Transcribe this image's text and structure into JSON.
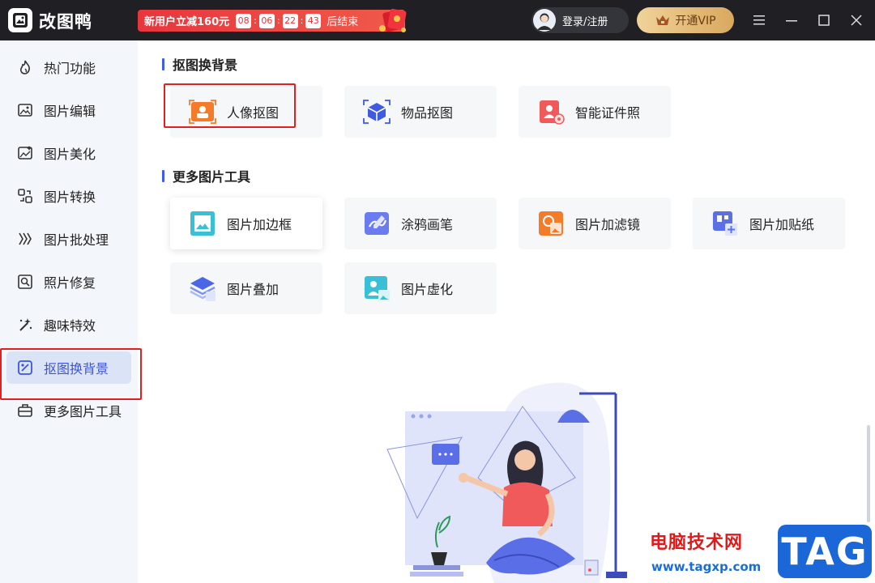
{
  "app": {
    "title": "改图鸭"
  },
  "promo": {
    "text": "新用户立减160元",
    "countdown": [
      "08",
      "06",
      "22",
      "43"
    ],
    "suffix": "后结束"
  },
  "header": {
    "login_label": "登录/注册",
    "vip_label": "开通VIP"
  },
  "sidebar": {
    "items": [
      {
        "label": "热门功能",
        "icon": "flame-icon"
      },
      {
        "label": "图片编辑",
        "icon": "image-edit-icon"
      },
      {
        "label": "图片美化",
        "icon": "image-beautify-icon"
      },
      {
        "label": "图片转换",
        "icon": "convert-icon"
      },
      {
        "label": "图片批处理",
        "icon": "batch-icon"
      },
      {
        "label": "照片修复",
        "icon": "photo-repair-icon"
      },
      {
        "label": "趣味特效",
        "icon": "magic-wand-icon"
      },
      {
        "label": "抠图换背景",
        "icon": "cutout-icon",
        "active": true
      },
      {
        "label": "更多图片工具",
        "icon": "toolbox-icon"
      }
    ]
  },
  "sections": {
    "cutout": {
      "title": "抠图换背景",
      "tools": [
        {
          "label": "人像抠图",
          "icon": "portrait-cutout-icon"
        },
        {
          "label": "物品抠图",
          "icon": "object-cutout-icon"
        },
        {
          "label": "智能证件照",
          "icon": "id-photo-icon"
        }
      ]
    },
    "more": {
      "title": "更多图片工具",
      "tools": [
        {
          "label": "图片加边框",
          "icon": "frame-icon"
        },
        {
          "label": "涂鸦画笔",
          "icon": "brush-icon"
        },
        {
          "label": "图片加滤镜",
          "icon": "filter-icon"
        },
        {
          "label": "图片加贴纸",
          "icon": "sticker-icon"
        },
        {
          "label": "图片叠加",
          "icon": "layers-icon"
        },
        {
          "label": "图片虚化",
          "icon": "blur-icon"
        }
      ]
    }
  },
  "watermark": {
    "text": "电脑技术网",
    "url": "www.tagxp.com",
    "tag": "TAG"
  },
  "colors": {
    "accent": "#3d55d8",
    "highlight": "#e22020",
    "titlebar": "#1f1f24",
    "sidebar_bg": "#f3f6fb"
  }
}
